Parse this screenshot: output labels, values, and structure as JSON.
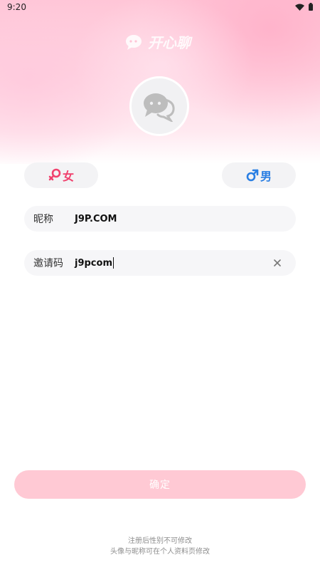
{
  "status_bar": {
    "time": "9:20",
    "wifi_icon": "wifi-icon",
    "battery_icon": "battery-icon"
  },
  "header": {
    "logo_text": "开心聊",
    "logo_icon": "chat-bubble-icon"
  },
  "avatar": {
    "icon": "chat-bubbles-icon"
  },
  "gender": {
    "female": {
      "label": "女",
      "icon": "female-symbol-icon",
      "color": "#f0426e"
    },
    "male": {
      "label": "男",
      "icon": "male-symbol-icon",
      "color": "#2a7fe3"
    }
  },
  "form": {
    "nickname": {
      "label": "昵称",
      "value": "J9P.COM"
    },
    "invite_code": {
      "label": "邀请码",
      "value": "j9pcom",
      "clear_icon": "close-icon"
    }
  },
  "confirm_button": {
    "label": "确定",
    "color": "#ffc9d4"
  },
  "footer": {
    "line1": "注册后性别不可修改",
    "line2": "头像与昵称可在个人资料页修改"
  }
}
